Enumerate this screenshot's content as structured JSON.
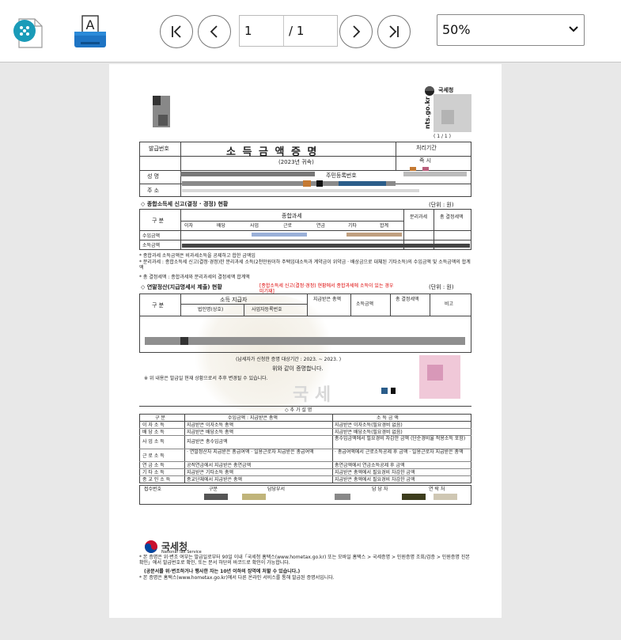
{
  "toolbar": {
    "page_current": "1",
    "page_total": "/ 1",
    "zoom": "50%"
  },
  "document": {
    "agency_small": "국세청",
    "page_indicator": "( 1 / 1 )",
    "issue_no_label": "발급번호",
    "title": "소 득 금 액 증 명",
    "year": "(2023년 귀속)",
    "processing_period_label": "처리기간",
    "processing_period_value": "즉  시",
    "name_label": "성    명",
    "resident_no_label": "주민등록번호",
    "address_label": "주    소",
    "section1_title": "◇ 종합소득세 신고(결정 · 경정) 현황",
    "unit_label": "(단위 : 원)",
    "col_division": "구 분",
    "col_comprehensive": "종합과세",
    "sub_headers": [
      "이자",
      "배당",
      "사업",
      "근로",
      "연금",
      "기타",
      "합계"
    ],
    "col_separate": "분리과세",
    "col_tax": "총 결정세액",
    "row_income": "수입금액",
    "row_amount": "소득금액",
    "notes1": [
      "* 종합과세 소득금액은 비과세소득을 공제하고 합한 금액임",
      "* 분리과세 : 종합소득세 신고(결정·경정)한 분리과세 소득(2천만원이하 주택임대소득과 계약금이 위약금 · 배상금으로 대체된 기타소득)의 수입금액 및 소득금액의 합계액",
      "* 총 결정세액 : 종합과세와 분리과세의 결정세액 합계액"
    ],
    "section2_title": "◇ 연말정산(지급명세서 제출) 현황",
    "section2_note": "[종합소득세 신고(결정·경정) 현황에서 종합과세에 소득이 있는 경우 미기재]",
    "col_payer": "소득 지급자",
    "col_corp_name": "법인명(상호)",
    "col_biz_no": "사업자등록번호",
    "col_paid_income": "지급받은 총액",
    "col_income_amount": "소득금액",
    "col_tax2": "총 결정세액",
    "col_remarks": "비고",
    "purpose_line": "(납세자가 신청한 증명 대상기간 : 2023. ~ 2023. )",
    "certify_line": "위와 같이 증명합니다.",
    "change_note": "※ 위 내용은 발급일 현재 상황으로서 추후 변경될 수 있습니다.",
    "section3_title": "◇ 추 가 설 명",
    "expl_headers": [
      "구 분",
      "수입금액 : 지급받은 총액",
      "소 득 금 액"
    ],
    "expl_rows": [
      [
        "이 자 소 득",
        "지급받은 이자소득 총액",
        "지급받은 이자소득(필요경비 없음)"
      ],
      [
        "배 당 소 득",
        "지급받은 배당소득 총액",
        "지급받은 배당소득(필요경비 없음)"
      ],
      [
        "사 업 소 득",
        "지급받은 총수입금액",
        "총수입금액에서 필요경비 차감한 금액 (단순경비율 적용소득 포함)"
      ],
      [
        "근 로 소 득",
        "· 연말정산자 지급받은 총급여액 · 일용근로자 지급받은 총급여액",
        "· 총급여액에서 근로소득공제 후 금액 · 일용근로자 지급받은 총액"
      ],
      [
        "연 금 소 득",
        "공적연금에서 지급받은 총연금액",
        "총연금액에서 연금소득공제 후 금액"
      ],
      [
        "기 타 소 득",
        "지급받은 기타소득 총액",
        "지급받은 총액에서 필요경비 차감한 금액"
      ],
      [
        "종 교 인 소 득",
        "종교단체에서 지급받은 총액",
        "지급받은 총액에서 필요경비 차감한 금액"
      ]
    ],
    "footer_table_labels": [
      "접수번호",
      "구분",
      "담당부서",
      "담 당 자",
      "연 락 처"
    ],
    "footer_logo": "국세청",
    "footer_logo_en": "National Tax Service",
    "footer_notes": [
      "* 본 증명은 위·변조 여부는 발급일로부터 90일 이내「국세청 홈택스(www.hometax.go.kr) 또는 모바일 홈택스 > 국세증명 > 민원증명 조회/검증 > 민원증명 진본 확인」에서 발급번호로 확인, 또는 문서 하단의 바코드로 확인이 가능합니다.",
      "(공문서를 위·변조하거나 행사한 자는 10년 이하의 징역에 처할 수 있습니다.)",
      "* 본 증명은 홈택스(www.hometax.go.kr)에서 다른 온라인 서비스를 통해 발급된 증명서입니다."
    ]
  }
}
